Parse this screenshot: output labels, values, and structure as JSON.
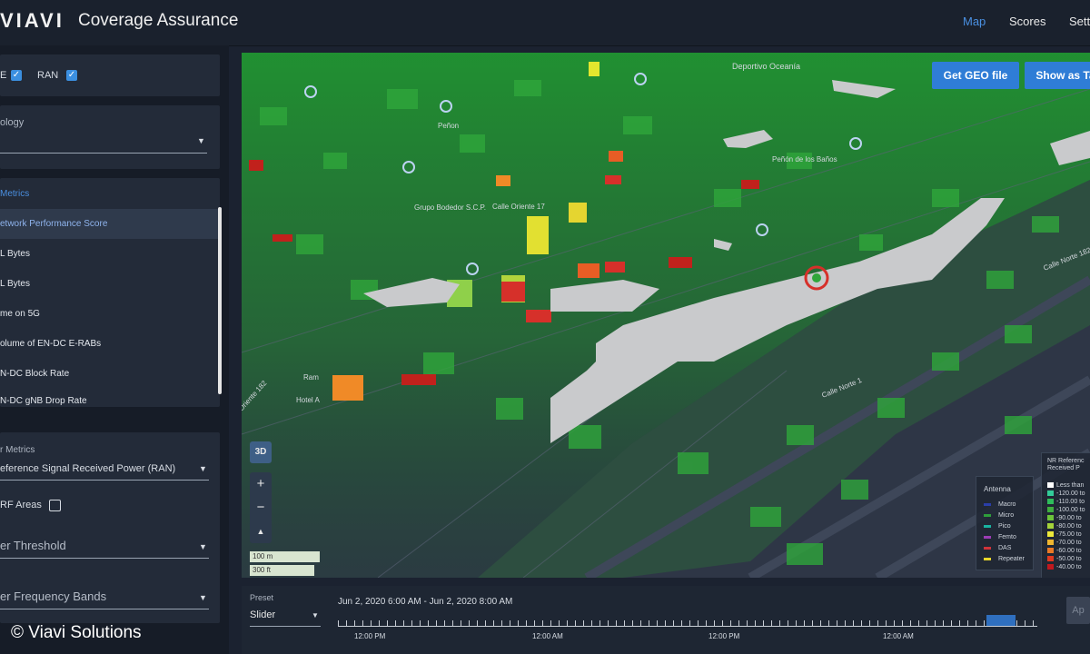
{
  "header": {
    "logo": "VIAVI",
    "title": "Coverage Assurance",
    "nav": [
      "Map",
      "Scores",
      "Sett"
    ]
  },
  "sidebar": {
    "layer_label_1": "E",
    "layer_label_2": "RAN",
    "technology_label": "ology",
    "metrics_header": "Metrics",
    "metrics": [
      "etwork Performance Score",
      "L Bytes",
      "L Bytes",
      "me on 5G",
      "olume of EN-DC E-RABs",
      "N-DC Block Rate",
      "N-DC gNB Drop Rate"
    ],
    "layer_metrics_label": "r Metrics",
    "layer_metric_value": "eference Signal Received Power  (RAN)",
    "rf_areas_label": "RF Areas",
    "threshold_label": "er Threshold",
    "bands_label": "er Frequency Bands"
  },
  "map": {
    "get_geo_button": "Get GEO file",
    "show_as_button": "Show as Ta",
    "view_3d": "3D",
    "zoom_in": "+",
    "zoom_out": "−",
    "compass": "▲",
    "scale_m": "100 m",
    "scale_ft": "300 ft",
    "labels": {
      "deportivo": "Deportivo Oceanía",
      "penon": "Peñón de los Baños",
      "calle_norte": "Calle Norte 1",
      "calle_norte_182": "Calle Norte 182",
      "oriente": "Oriente 182",
      "hotel": "Hotel A",
      "ramos": "Ram",
      "calle_oriente": "Calle Oriente 17",
      "grupo": "Grupo Bodedor S.C.P.",
      "penon_small": "Peñon"
    },
    "antenna_legend": {
      "title": "Antenna",
      "items": [
        {
          "label": "Macro",
          "color": "#2a3ea8"
        },
        {
          "label": "Micro",
          "color": "#2e9e3a"
        },
        {
          "label": "Pico",
          "color": "#19b3a0"
        },
        {
          "label": "Femto",
          "color": "#9c3db5"
        },
        {
          "label": "DAS",
          "color": "#d0333a"
        },
        {
          "label": "Repeater",
          "color": "#e8d62a"
        }
      ]
    },
    "rsrp_legend": {
      "title": "NR Referenc Received P",
      "items": [
        {
          "label": "Less than",
          "color": "#ffffff"
        },
        {
          "label": "-120.00 to",
          "color": "#33cc99"
        },
        {
          "label": "-110.00 to",
          "color": "#2ebd5b"
        },
        {
          "label": "-100.00 to",
          "color": "#3fae3f"
        },
        {
          "label": "-90.00 to",
          "color": "#6cc33a"
        },
        {
          "label": "-80.00 to",
          "color": "#a5d43a"
        },
        {
          "label": "-75.00 to",
          "color": "#ede93a"
        },
        {
          "label": "-70.00 to",
          "color": "#f0b62f"
        },
        {
          "label": "-60.00 to",
          "color": "#ea7a26"
        },
        {
          "label": "-50.00 to",
          "color": "#e03a1f"
        },
        {
          "label": "-40.00 to",
          "color": "#c0181e"
        }
      ]
    }
  },
  "timeline": {
    "preset_label": "Preset",
    "preset_value": "Slider",
    "range": "Jun 2, 2020 6:00 AM - Jun 2, 2020 8:00 AM",
    "ticks": [
      "12:00 PM",
      "12:00 AM",
      "12:00 PM",
      "12:00 AM"
    ],
    "apply": "Ap"
  },
  "copyright": "© Viavi Solutions"
}
